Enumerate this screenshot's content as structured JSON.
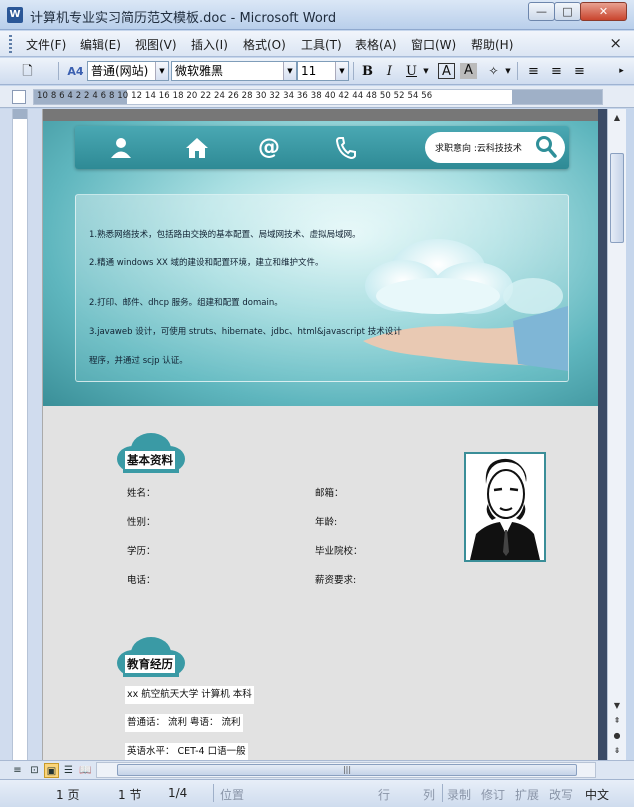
{
  "window": {
    "title": "计算机专业实习简历范文模板.doc - Microsoft Word",
    "app_icon": "W",
    "min": "—",
    "max": "□",
    "close": "✕"
  },
  "menu": {
    "items": [
      "文件(F)",
      "编辑(E)",
      "视图(V)",
      "插入(I)",
      "格式(O)",
      "工具(T)",
      "表格(A)",
      "窗口(W)",
      "帮助(H)"
    ],
    "close_doc": "×"
  },
  "toolbar": {
    "style": "普通(网站)",
    "font": "微软雅黑",
    "size": "11",
    "bold": "B",
    "italic": "I",
    "underline": "U",
    "char_border": "A",
    "char_shade": "A"
  },
  "ruler": {
    "numbers": "10  8  6  4  2     2  4  6  8  10  12  14  16  18  20  22  24  26  28  30  32  34  36  38  40  42  44     48  50  52  54  56"
  },
  "document": {
    "search_text": "求职意向 :云科技技术",
    "banner_lines": [
      "1.熟悉网络技术，包括路由交换的基本配置、局域网技术、虚拟局域网。",
      "2.精通 windows XX 域的建设和配置环境，建立和维护文件。",
      "2.打印、邮件、dhcp 服务。组建和配置 domain。",
      "3.javaweb 设计，可使用 struts、hibernate、jdbc、html&javascript 技术设计",
      "程序，并通过 scjp 认证。"
    ],
    "basic_title": "基本资料",
    "fields_left": [
      "姓名：",
      "性别：",
      "学历：",
      "电话："
    ],
    "fields_right": [
      "邮箱：",
      "年龄:",
      "毕业院校：",
      "薪资要求:"
    ],
    "edu_title": "教育经历",
    "edu_lines": [
      "xx 航空航天大学        计算机        本科",
      "普通话：  流利  粤语：  流利",
      "英语水平：  CET-4  口语一般"
    ],
    "accent_color": "#3a9aa5"
  },
  "statusbar": {
    "page": "1 页",
    "section": "1 节",
    "pages": "1/4",
    "position": "位置",
    "line": "行",
    "col": "列",
    "rec": "录制",
    "trk": "修订",
    "ext": "扩展",
    "ovr": "改写",
    "lang": "中文"
  }
}
